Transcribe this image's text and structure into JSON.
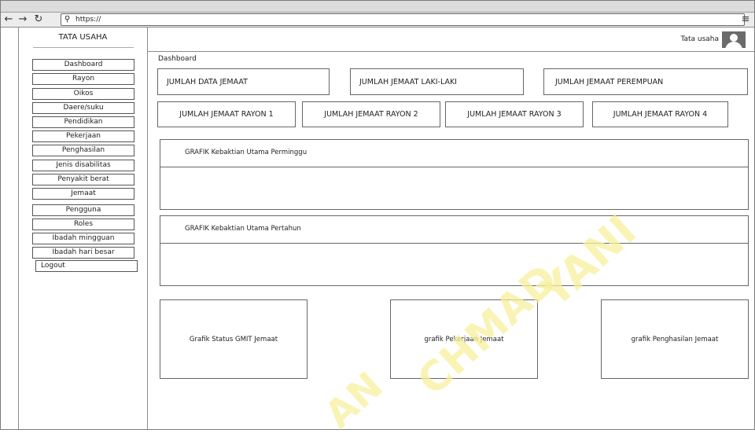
{
  "browser": {
    "url": "https://",
    "back_icon": "arrow-left-icon",
    "forward_icon": "arrow-right-icon",
    "reload_icon": "reload-icon",
    "search_icon": "magnifier-icon",
    "menu_icon": "hamburger-menu-icon"
  },
  "sidebar": {
    "title": "TATA USAHA",
    "items": [
      {
        "label": "Dashboard"
      },
      {
        "label": "Rayon"
      },
      {
        "label": "Oikos"
      },
      {
        "label": "Daere/suku"
      },
      {
        "label": "Pendidikan"
      },
      {
        "label": "Pekerjaan"
      },
      {
        "label": "Penghasilan"
      },
      {
        "label": "Jenis disabilitas"
      },
      {
        "label": "Penyakit berat"
      },
      {
        "label": "Jemaat"
      },
      {
        "label": "Pengguna"
      },
      {
        "label": "Roles"
      },
      {
        "label": "Ibadah mingguan"
      },
      {
        "label": "Ibadah hari besar"
      }
    ],
    "logout": "Logout"
  },
  "header": {
    "user_label": "Tata usaha",
    "avatar_icon": "user-avatar-icon"
  },
  "main": {
    "page_title": "Dashboard",
    "summary_cards": [
      {
        "label": "JUMLAH DATA JEMAAT"
      },
      {
        "label": "JUMLAH JEMAAT LAKI-LAKI"
      },
      {
        "label": "JUMLAH JEMAAT PEREMPUAN"
      }
    ],
    "rayon_cards": [
      {
        "label": "JUMLAH JEMAAT RAYON 1"
      },
      {
        "label": "JUMLAH JEMAAT RAYON 2"
      },
      {
        "label": "JUMLAH JEMAAT RAYON 3"
      },
      {
        "label": "JUMLAH JEMAAT RAYON 4"
      }
    ],
    "panels": [
      {
        "title": "GRAFIK Kebaktian Utama Perminggu"
      },
      {
        "title": "GRAFIK Kebaktian Utama Pertahun"
      }
    ],
    "chart_boxes": [
      {
        "label": "Grafik Status GMIT Jemaat"
      },
      {
        "label": "grafik Pekerjaan Jemaat"
      },
      {
        "label": "grafik Penghasilan Jemaat"
      }
    ]
  },
  "watermark": {
    "line1": "YANI",
    "line2": "CHMAD",
    "line3": "AN"
  },
  "colors": {
    "watermark": "#f7f19d",
    "border": "#666666",
    "avatar": "#6b6b6b"
  }
}
